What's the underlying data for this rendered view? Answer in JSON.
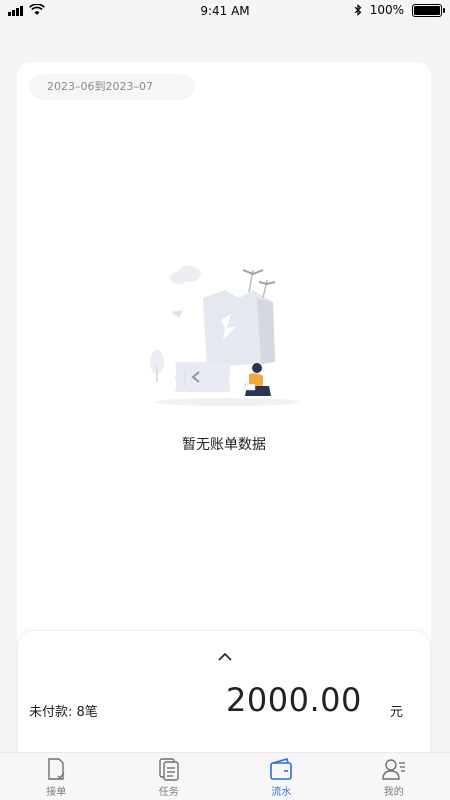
{
  "status_bar": {
    "time": "9:41 AM",
    "battery": "100%",
    "battery_level": 1.0,
    "signal_bars": 4
  },
  "filter": {
    "date_range": "2023–06到2023–07"
  },
  "empty_state": {
    "message": "暂无账单数据",
    "illustration": "empty-bill-illustration"
  },
  "summary": {
    "unpaid_label": "未付款: 8笔",
    "amount": "2000.00",
    "currency": "元"
  },
  "tabs": [
    {
      "label": "接单",
      "icon": "document-check-icon",
      "active": false
    },
    {
      "label": "任务",
      "icon": "task-list-icon",
      "active": false
    },
    {
      "label": "流水",
      "icon": "wallet-icon",
      "active": true
    },
    {
      "label": "我的",
      "icon": "profile-icon",
      "active": false
    }
  ],
  "colors": {
    "accent": "#2f6bd8",
    "background": "#f5f5f7",
    "card": "#ffffff",
    "muted_text": "#8a8a8a"
  }
}
